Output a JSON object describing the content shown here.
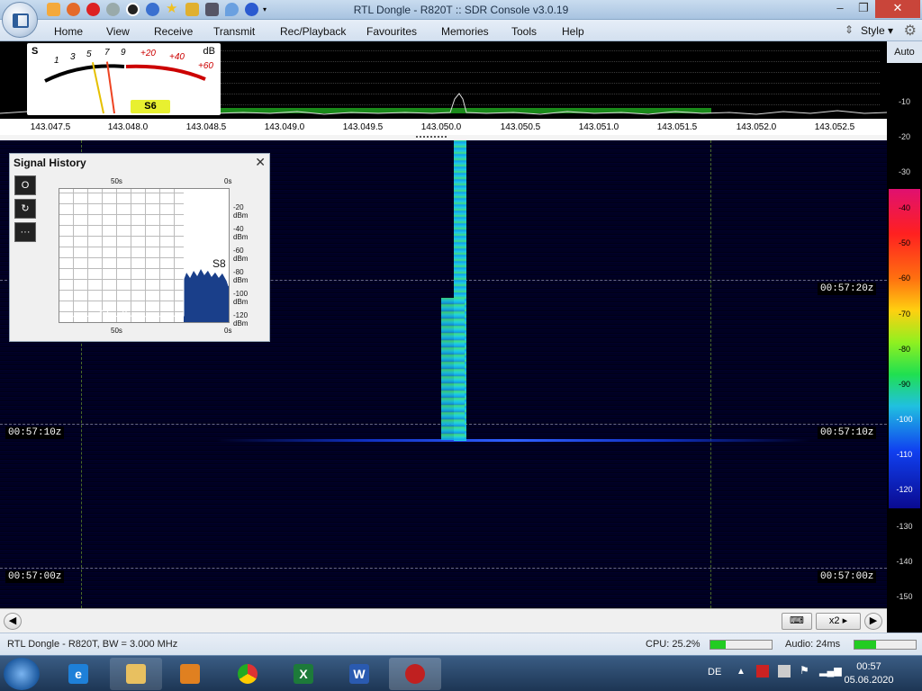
{
  "window": {
    "title": "RTL Dongle - R820T :: SDR Console v3.0.19",
    "controls": [
      "–",
      "❐",
      "✕"
    ]
  },
  "quick_access": [
    "home-icon",
    "settings-icon",
    "record-icon",
    "play-icon",
    "stop-icon",
    "plus-icon",
    "star-icon",
    "lock-icon",
    "camera-icon",
    "drop-icon",
    "undo-icon",
    "dropdown-icon"
  ],
  "menu": {
    "items": [
      "Home",
      "View",
      "Receive",
      "Transmit",
      "Rec/Playback",
      "Favourites",
      "Memories",
      "Tools",
      "Help"
    ],
    "style_label": "Style"
  },
  "smeter": {
    "s_label": "S",
    "db_label": "dB",
    "s_ticks": [
      "1",
      "3",
      "5",
      "7",
      "9"
    ],
    "db_ticks": [
      "+20",
      "+40",
      "+60"
    ],
    "reading": "S6"
  },
  "spectrum": {
    "freq_ticks": [
      "143.047.5",
      "143.048.0",
      "143.048.5",
      "143.049.0",
      "143.049.5",
      "143.050.0",
      "143.050.5",
      "143.051.0",
      "143.051.5",
      "143.052.0",
      "143.052.5"
    ]
  },
  "waterfall": {
    "time_labels": [
      "00:57:20z",
      "00:57:10z",
      "00:57:00z"
    ],
    "left_time_labels": [
      "00:57:10z",
      "00:57:00z"
    ]
  },
  "signal_history": {
    "title": "Signal History",
    "close": "✕",
    "buttons": [
      "O",
      "↻",
      "···"
    ],
    "top_time_left": "50s",
    "top_time_right": "0s",
    "bottom_time_left": "50s",
    "bottom_time_right": "0s",
    "dbm_labels": [
      "-20 dBm",
      "-40 dBm",
      "-60 dBm",
      "-80 dBm",
      "-100 dBm",
      "-120 dBm"
    ],
    "s_reading": "S8"
  },
  "scale": {
    "auto_label": "Auto",
    "upper_labels": [
      "-10",
      "-20",
      "-30"
    ],
    "band_labels": [
      "-40",
      "-50",
      "-60",
      "-70",
      "-80",
      "-90",
      "-100",
      "-110",
      "-120"
    ],
    "lower_labels": [
      "-130",
      "-140",
      "-150"
    ]
  },
  "bottom_bar": {
    "zoom": "x2"
  },
  "status": {
    "device": "RTL Dongle - R820T, BW = 3.000 MHz",
    "cpu": "CPU: 25.2%",
    "cpu_fraction": 0.25,
    "audio": "Audio: 24ms",
    "audio_fraction": 0.35
  },
  "taskbar": {
    "apps": [
      "ie-icon",
      "explorer-icon",
      "media-player-icon",
      "chrome-icon",
      "excel-icon",
      "word-icon",
      "sdr-console-icon"
    ],
    "app_letters": [
      "e",
      "",
      "",
      "",
      "X",
      "W",
      ""
    ],
    "lang": "DE",
    "time": "00:57",
    "date": "05.06.2020"
  }
}
